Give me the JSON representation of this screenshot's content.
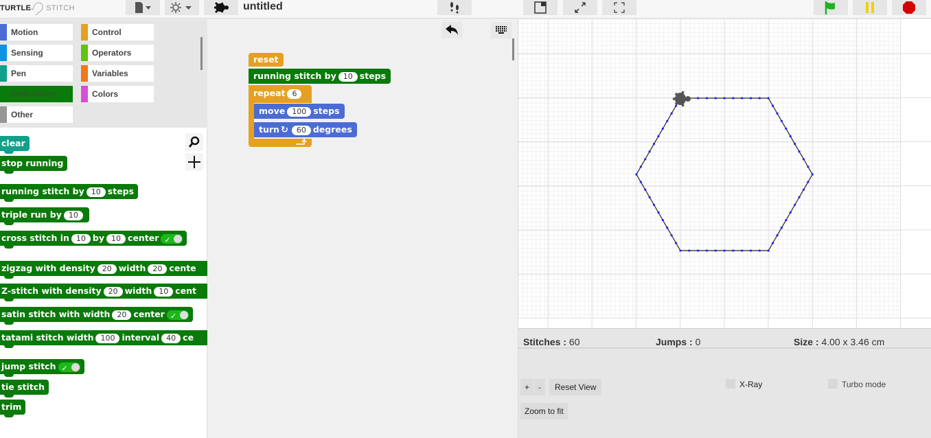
{
  "app": {
    "logo_left": "TURTLE",
    "logo_right": "STITCH",
    "project_title": "untitled"
  },
  "toolbar": {
    "icons": [
      "file-icon",
      "settings-icon",
      "turtle-icon",
      "footprints-icon",
      "stage-layout-icon",
      "resize-icon",
      "fullscreen-icon",
      "green-flag-icon",
      "pause-icon",
      "stop-icon"
    ],
    "colors": {
      "flag": "#1db31d",
      "pause": "#f2d000",
      "stop": "#d40000"
    }
  },
  "categories": [
    {
      "label": "Motion",
      "color": "#4a6cd4"
    },
    {
      "label": "Control",
      "color": "#e6a020"
    },
    {
      "label": "Sensing",
      "color": "#0f93e0"
    },
    {
      "label": "Operators",
      "color": "#62c213"
    },
    {
      "label": "Pen",
      "color": "#11a08a"
    },
    {
      "label": "Variables",
      "color": "#f3761d"
    },
    {
      "label": "Embroidery",
      "color": "#0a7a0a",
      "selected": true
    },
    {
      "label": "Colors",
      "color": "#d94ed9"
    },
    {
      "label": "Other",
      "color": "#969696"
    }
  ],
  "palette": {
    "clear": "clear",
    "stop": "stop running",
    "running": {
      "a": "running stitch by",
      "v": "10",
      "b": "steps"
    },
    "triple": {
      "a": "triple run by",
      "v": "10"
    },
    "cross": {
      "a": "cross stitch in",
      "v1": "10",
      "b": "by",
      "v2": "10",
      "c": "center"
    },
    "zigzag": {
      "a": "zigzag with density",
      "v1": "20",
      "b": "width",
      "v2": "20",
      "c": "cente"
    },
    "zstitch": {
      "a": "Z-stitch with density",
      "v1": "20",
      "b": "width",
      "v2": "10",
      "c": "cent"
    },
    "satin": {
      "a": "satin stitch with width",
      "v": "20",
      "b": "center"
    },
    "tatami": {
      "a": "tatami stitch width",
      "v1": "100",
      "b": "interval",
      "v2": "40",
      "c": "ce"
    },
    "jump": "jump stitch",
    "tie": "tie stitch",
    "trim": "trim"
  },
  "script": {
    "reset": "reset",
    "running": {
      "a": "running stitch by",
      "v": "10",
      "b": "steps"
    },
    "repeat": {
      "a": "repeat",
      "v": "6"
    },
    "move": {
      "a": "move",
      "v": "100",
      "b": "steps"
    },
    "turn": {
      "a": "turn",
      "v": "60",
      "b": "degrees"
    }
  },
  "stats": {
    "stitches_label": "Stitches :",
    "stitches": "60",
    "jumps_label": "Jumps :",
    "jumps": "0",
    "size_label": "Size :",
    "size": "4.00 x 3.46 cm"
  },
  "controls": {
    "zoom_in": "+",
    "zoom_out": "-",
    "reset_view": "Reset View",
    "zoom_fit": "Zoom to fit",
    "xray": "X-Ray",
    "turbo": "Turbo mode",
    "xray_checked": false,
    "turbo_checked": false
  },
  "design": {
    "sides": 6,
    "side_length_steps": 100,
    "stitch_length_steps": 10,
    "turn_degrees": 60,
    "stitch_color": "#2020ff",
    "line_color": "#333333"
  }
}
